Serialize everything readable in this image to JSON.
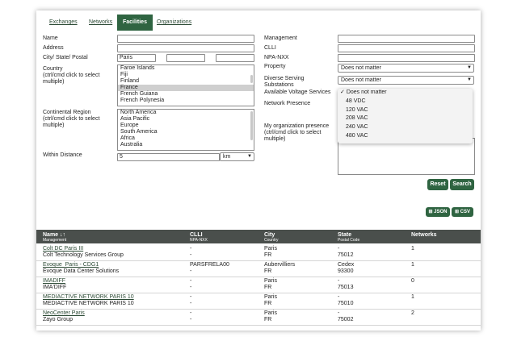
{
  "tabs": [
    "Exchanges",
    "Networks",
    "Facilities",
    "Organizations"
  ],
  "form": {
    "name_label": "Name",
    "address_label": "Address",
    "city_label": "City/ State/ Postal",
    "city_value": "Paris",
    "country_label": "Country",
    "country_hint": "(ctrl/cmd click to select multiple)",
    "countries": [
      "Faroe Islands",
      "Fiji",
      "Finland",
      "France",
      "French Guiana",
      "French Polynesia"
    ],
    "region_label": "Continental Region",
    "region_hint": "(ctrl/cmd click to select multiple)",
    "regions": [
      "North America",
      "Asia Pacific",
      "Europe",
      "South America",
      "Africa",
      "Australia"
    ],
    "distance_label": "Within Distance",
    "distance_value": "5",
    "distance_unit": "km",
    "management_label": "Management",
    "clli_label": "CLLI",
    "npanxx_label": "NPA-NXX",
    "property_label": "Property",
    "property_value": "Does not matter",
    "diverse_label": "Diverse Serving Substations",
    "diverse_value": "Does not matter",
    "voltage_label": "Available Voltage Services",
    "presence_label": "Network Presence",
    "myorg_label": "My organization presence (ctrl/cmd click to select multiple)",
    "voltage_options": [
      "Does not matter",
      "48 VDC",
      "120 VAC",
      "208 VAC",
      "240 VAC",
      "480 VAC"
    ],
    "voltage_checkmark": "✓",
    "reset_label": "Reset",
    "search_label": "Search",
    "json_label": "JSON",
    "csv_label": "CSV"
  },
  "table": {
    "headers": [
      {
        "main": "Name",
        "sub": "Management",
        "sort_icon": "↓↑"
      },
      {
        "main": "CLLI",
        "sub": "NPA-NXX"
      },
      {
        "main": "City",
        "sub": "Country"
      },
      {
        "main": "State",
        "sub": "Postal Code"
      },
      {
        "main": "Networks",
        "sub": ""
      }
    ],
    "rows": [
      {
        "name": "Colt DC Paris III",
        "mgmt": "Colt Technology Services Group",
        "clli": "-",
        "npa": "-",
        "city": "Paris",
        "country": "FR",
        "state": "-",
        "postal": "75012",
        "networks": "1"
      },
      {
        "name": "Evoque_Paris - CDG1",
        "mgmt": "Evoque Data Center Solutions",
        "clli": "PARSFRELA00",
        "npa": "-",
        "city": "Aubervilliers",
        "country": "FR",
        "state": "Cedex",
        "postal": "93300",
        "networks": "1"
      },
      {
        "name": "IMADIFF",
        "mgmt": "IMA'DIFF",
        "clli": "-",
        "npa": "-",
        "city": "Paris",
        "country": "FR",
        "state": "-",
        "postal": "75013",
        "networks": "0"
      },
      {
        "name": "MEDIACTIVE NETWORK PARIS 10",
        "mgmt": "MEDIACTIVE NETWORK PARIS 10",
        "clli": "-",
        "npa": "-",
        "city": "Paris",
        "country": "FR",
        "state": "-",
        "postal": "75010",
        "networks": "1"
      },
      {
        "name": "NeoCenter Paris",
        "mgmt": "Zayo Group",
        "clli": "-",
        "npa": "-",
        "city": "Paris",
        "country": "FR",
        "state": "-",
        "postal": "75002",
        "networks": "2"
      }
    ]
  }
}
